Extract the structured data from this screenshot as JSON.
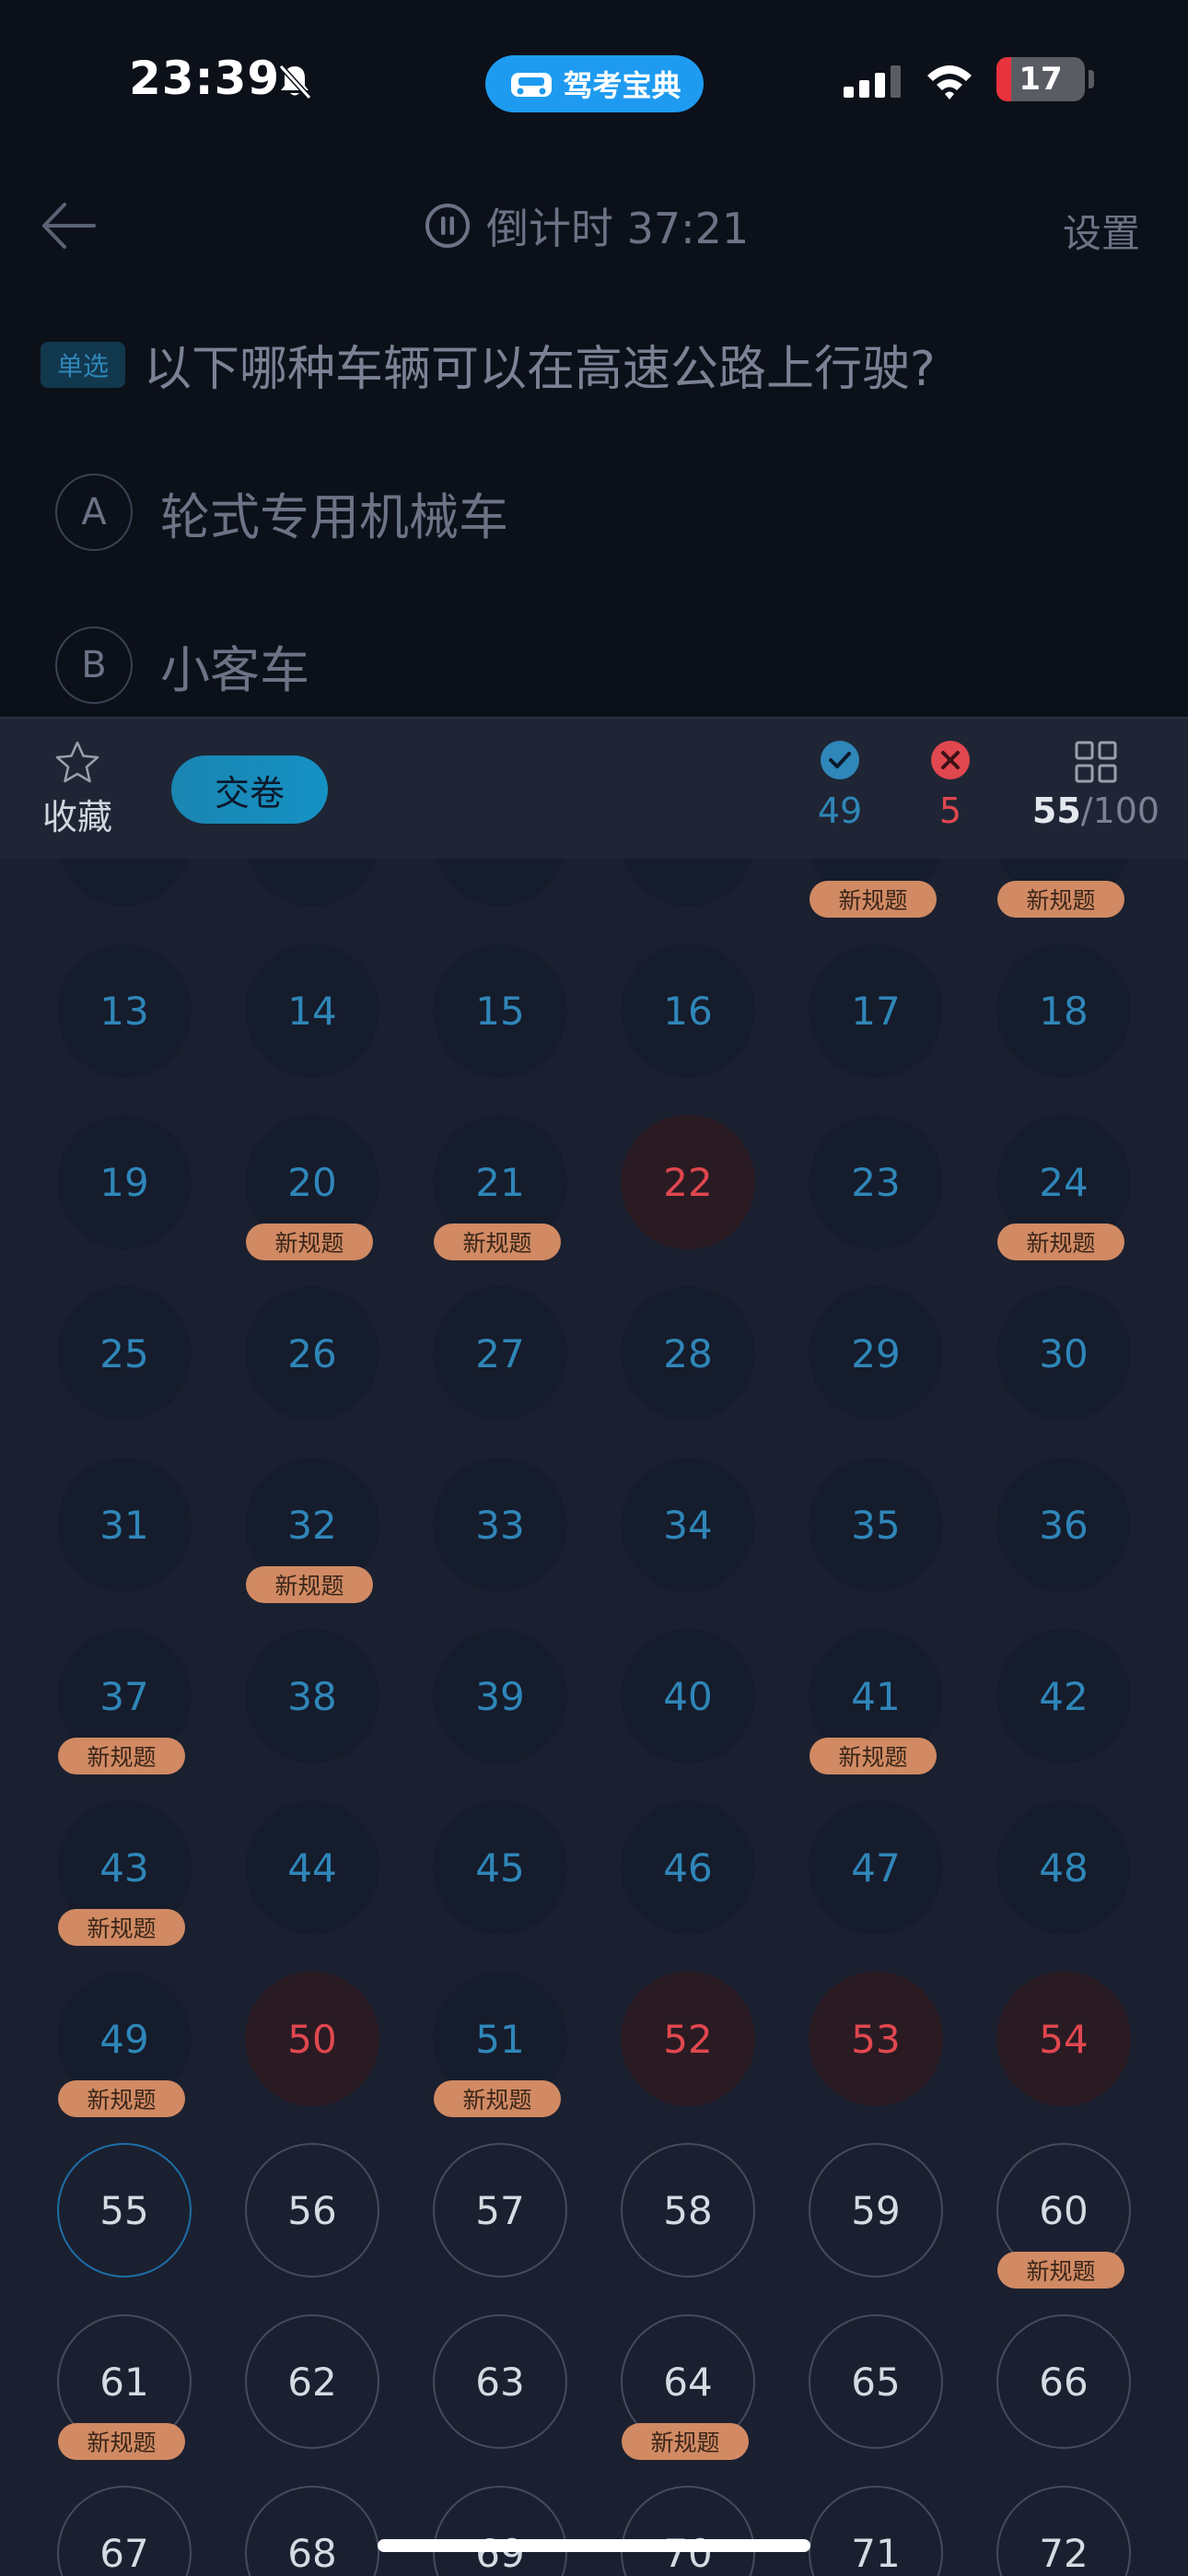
{
  "status_bar": {
    "time": "23:39",
    "app_label": "驾考宝典",
    "battery_level": "17",
    "battery_fraction": 0.17,
    "icons": [
      "bell-slash-icon",
      "car-icon",
      "cellular-signal-icon",
      "wifi-icon",
      "battery-icon"
    ]
  },
  "nav": {
    "back_icon": "arrow-left-icon",
    "timer_icon": "pause-circle-icon",
    "timer_text": "倒计时 37:21",
    "settings_label": "设置"
  },
  "question": {
    "type_badge": "单选",
    "text": "以下哪种车辆可以在高速公路上行驶?",
    "options": [
      {
        "letter": "A",
        "text": "轮式专用机械车"
      },
      {
        "letter": "B",
        "text": "小客车"
      }
    ]
  },
  "sheet": {
    "favorite_label": "收藏",
    "favorite_icon": "star-outline-icon",
    "submit_label": "交卷",
    "correct_count": "49",
    "wrong_count": "5",
    "progress_current": "55",
    "progress_separator": "/",
    "progress_total": "100",
    "tag_label": "新规题",
    "colors": {
      "accent_blue": "#2f86b8",
      "error_red": "#e0474f",
      "tag_orange": "#d18a63",
      "submit_button": "#1591c4"
    }
  },
  "questions": [
    {
      "number": "13",
      "status": "correct",
      "tag": false
    },
    {
      "number": "14",
      "status": "correct",
      "tag": false
    },
    {
      "number": "15",
      "status": "correct",
      "tag": false
    },
    {
      "number": "16",
      "status": "correct",
      "tag": false
    },
    {
      "number": "17",
      "status": "correct",
      "tag": false
    },
    {
      "number": "18",
      "status": "correct",
      "tag": false
    },
    {
      "number": "19",
      "status": "correct",
      "tag": false
    },
    {
      "number": "20",
      "status": "correct",
      "tag": true
    },
    {
      "number": "21",
      "status": "correct",
      "tag": true
    },
    {
      "number": "22",
      "status": "wrong",
      "tag": false
    },
    {
      "number": "23",
      "status": "correct",
      "tag": false
    },
    {
      "number": "24",
      "status": "correct",
      "tag": true
    },
    {
      "number": "25",
      "status": "correct",
      "tag": false
    },
    {
      "number": "26",
      "status": "correct",
      "tag": false
    },
    {
      "number": "27",
      "status": "correct",
      "tag": false
    },
    {
      "number": "28",
      "status": "correct",
      "tag": false
    },
    {
      "number": "29",
      "status": "correct",
      "tag": false
    },
    {
      "number": "30",
      "status": "correct",
      "tag": false
    },
    {
      "number": "31",
      "status": "correct",
      "tag": false
    },
    {
      "number": "32",
      "status": "correct",
      "tag": true
    },
    {
      "number": "33",
      "status": "correct",
      "tag": false
    },
    {
      "number": "34",
      "status": "correct",
      "tag": false
    },
    {
      "number": "35",
      "status": "correct",
      "tag": false
    },
    {
      "number": "36",
      "status": "correct",
      "tag": false
    },
    {
      "number": "37",
      "status": "correct",
      "tag": true
    },
    {
      "number": "38",
      "status": "correct",
      "tag": false
    },
    {
      "number": "39",
      "status": "correct",
      "tag": false
    },
    {
      "number": "40",
      "status": "correct",
      "tag": false
    },
    {
      "number": "41",
      "status": "correct",
      "tag": true
    },
    {
      "number": "42",
      "status": "correct",
      "tag": false
    },
    {
      "number": "43",
      "status": "correct",
      "tag": true
    },
    {
      "number": "44",
      "status": "correct",
      "tag": false
    },
    {
      "number": "45",
      "status": "correct",
      "tag": false
    },
    {
      "number": "46",
      "status": "correct",
      "tag": false
    },
    {
      "number": "47",
      "status": "correct",
      "tag": false
    },
    {
      "number": "48",
      "status": "correct",
      "tag": false
    },
    {
      "number": "49",
      "status": "correct",
      "tag": true
    },
    {
      "number": "50",
      "status": "wrong",
      "tag": false
    },
    {
      "number": "51",
      "status": "correct",
      "tag": true
    },
    {
      "number": "52",
      "status": "wrong",
      "tag": false
    },
    {
      "number": "53",
      "status": "wrong",
      "tag": false
    },
    {
      "number": "54",
      "status": "wrong",
      "tag": false
    },
    {
      "number": "55",
      "status": "current",
      "tag": false
    },
    {
      "number": "56",
      "status": "pending",
      "tag": false
    },
    {
      "number": "57",
      "status": "pending",
      "tag": false
    },
    {
      "number": "58",
      "status": "pending",
      "tag": false
    },
    {
      "number": "59",
      "status": "pending",
      "tag": false
    },
    {
      "number": "60",
      "status": "pending",
      "tag": true
    },
    {
      "number": "61",
      "status": "pending",
      "tag": true
    },
    {
      "number": "62",
      "status": "pending",
      "tag": false
    },
    {
      "number": "63",
      "status": "pending",
      "tag": false
    },
    {
      "number": "64",
      "status": "pending",
      "tag": true
    },
    {
      "number": "65",
      "status": "pending",
      "tag": false
    },
    {
      "number": "66",
      "status": "pending",
      "tag": false
    },
    {
      "number": "67",
      "status": "pending",
      "tag": false
    },
    {
      "number": "68",
      "status": "pending",
      "tag": false
    },
    {
      "number": "69",
      "status": "pending",
      "tag": false
    },
    {
      "number": "70",
      "status": "pending",
      "tag": false
    },
    {
      "number": "71",
      "status": "pending",
      "tag": false
    },
    {
      "number": "72",
      "status": "pending",
      "tag": false
    }
  ],
  "partial_row_tags": [
    false,
    false,
    false,
    false,
    true,
    true
  ]
}
